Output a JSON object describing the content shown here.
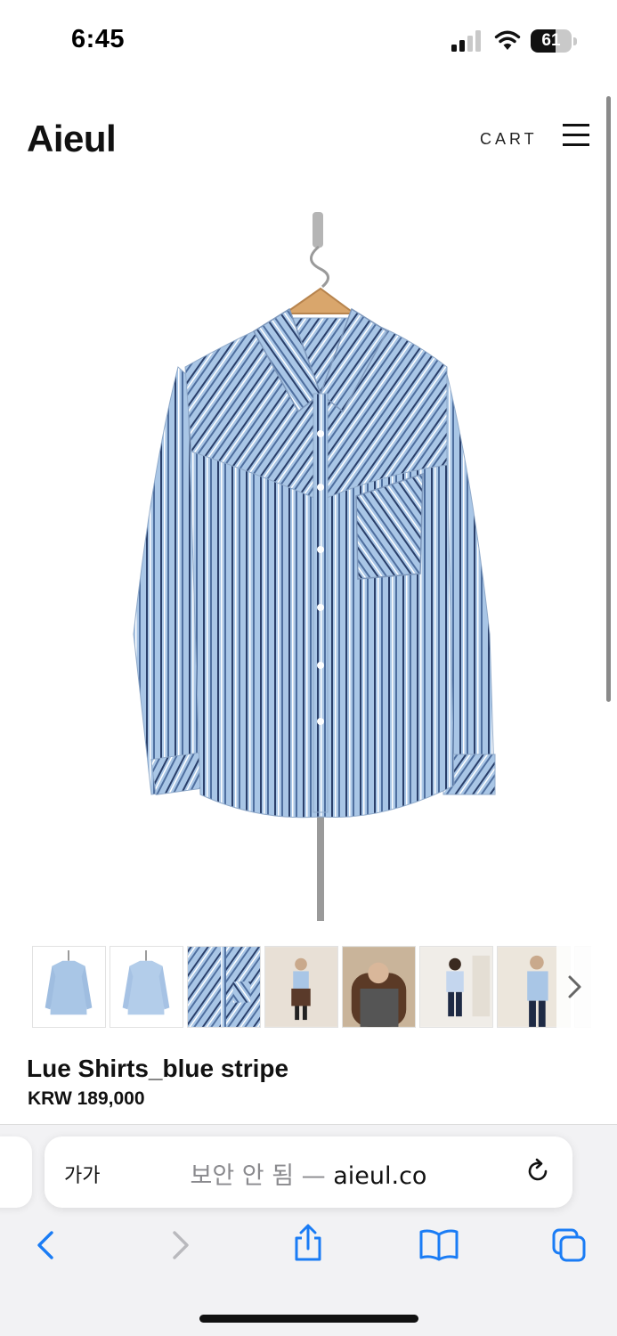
{
  "status_bar": {
    "time": "6:45",
    "battery": "61",
    "battery_level": 0.61,
    "signal_bars": 2,
    "signal_total": 4
  },
  "header": {
    "brand": "Aieul",
    "cart": "CART"
  },
  "product": {
    "name": "Lue Shirts_blue stripe",
    "price": "KRW 189,000",
    "colors": {
      "shirt": "#a9c6e6",
      "stripe": "#2a3f6a"
    },
    "thumbnails": [
      {
        "icon": "shirt-front-thumbnail"
      },
      {
        "icon": "shirt-back-thumbnail"
      },
      {
        "icon": "shirt-detail-thumbnail"
      },
      {
        "icon": "model-full-thumbnail"
      },
      {
        "icon": "model-seated-thumbnail"
      },
      {
        "icon": "model-back-thumbnail"
      },
      {
        "icon": "model-side-thumbnail"
      },
      {
        "icon": "partial-thumbnail"
      }
    ]
  },
  "browser": {
    "reader_label": "가가",
    "address_prefix": "보안 안 됨 —",
    "address_domain": "aieul.co",
    "accent": "#1a7cf5"
  }
}
